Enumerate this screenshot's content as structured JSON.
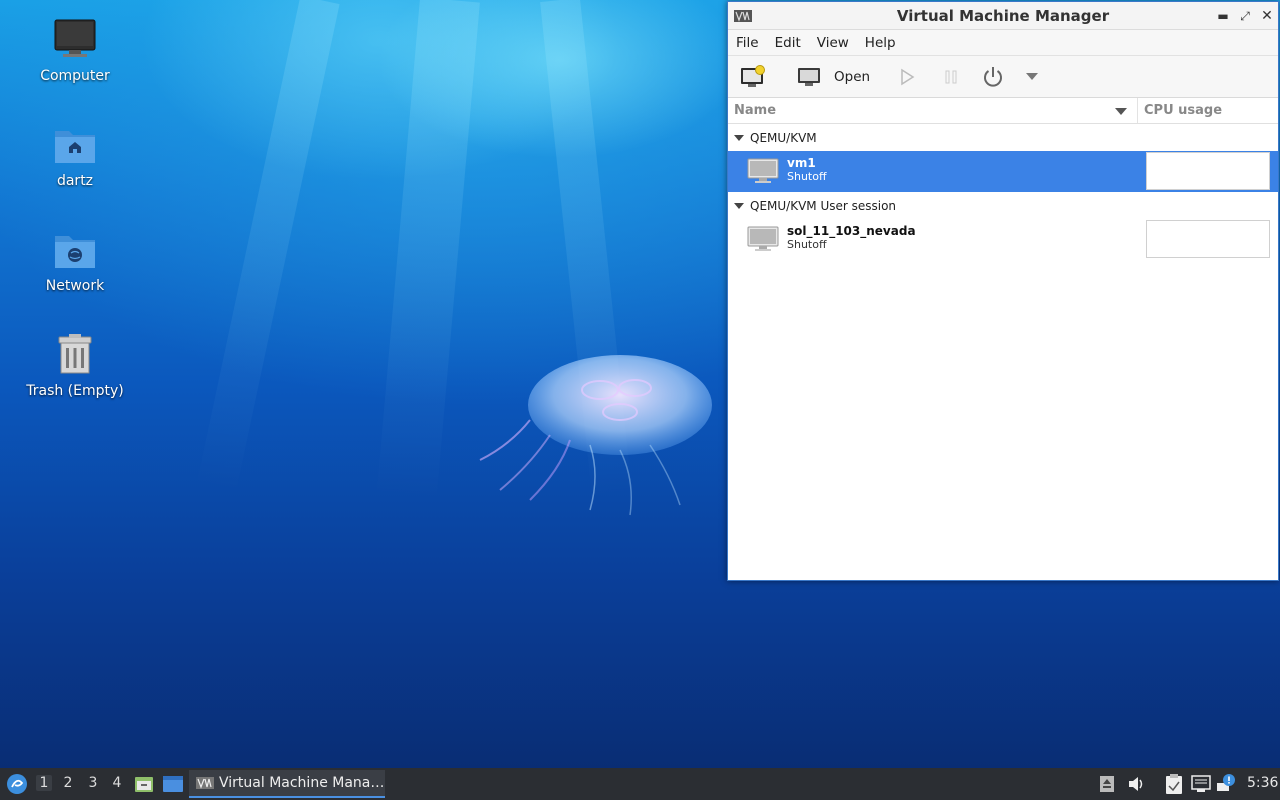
{
  "desktop": {
    "icons": [
      {
        "label": "Computer"
      },
      {
        "label": "dartz"
      },
      {
        "label": "Network"
      },
      {
        "label": "Trash (Empty)"
      }
    ]
  },
  "window": {
    "title": "Virtual Machine Manager",
    "menu": [
      "File",
      "Edit",
      "View",
      "Help"
    ],
    "toolbar": {
      "new_vm_icon": "new-vm-icon",
      "open_label": "Open",
      "run_icon": "play-icon",
      "pause_icon": "pause-icon",
      "shutdown_icon": "power-icon",
      "menu_icon": "dropdown-arrow-icon"
    },
    "columns": {
      "name": "Name",
      "cpu": "CPU usage"
    },
    "groups": [
      {
        "label": "QEMU/KVM",
        "vms": [
          {
            "name": "vm1",
            "status": "Shutoff",
            "selected": true
          }
        ]
      },
      {
        "label": "QEMU/KVM User session",
        "vms": [
          {
            "name": "sol_11_103_nevada",
            "status": "Shutoff",
            "selected": false
          }
        ]
      }
    ]
  },
  "taskbar": {
    "workspaces": [
      "1",
      "2",
      "3",
      "4"
    ],
    "active_task": "Virtual Machine Mana…",
    "clock": "5:36"
  },
  "colors": {
    "selection": "#3b82e6",
    "taskbar": "#2b2e33",
    "accent": "#4a90e2"
  }
}
